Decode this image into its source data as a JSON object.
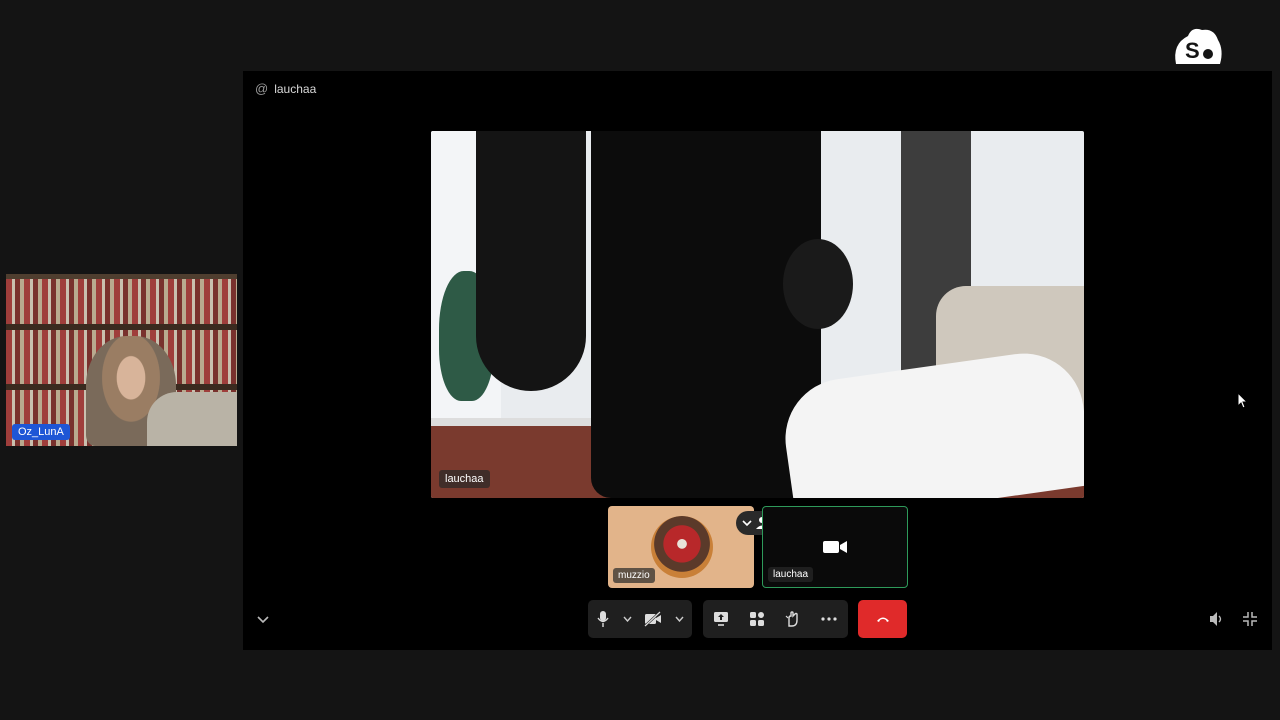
{
  "webcam": {
    "name": "Oz_LunA"
  },
  "brand": {
    "name": "streamyard"
  },
  "room": {
    "at_symbol": "@",
    "name": "lauchaa"
  },
  "main_video": {
    "participant": "lauchaa"
  },
  "thumbnails": [
    {
      "participant": "muzzio"
    },
    {
      "participant": "lauchaa"
    }
  ],
  "controls": {
    "group_a": [
      "microphone-icon",
      "chevron-down-icon",
      "camera-off-icon",
      "chevron-down-icon"
    ],
    "group_b": [
      "share-screen-icon",
      "apps-icon",
      "raise-hand-icon",
      "more-icon"
    ],
    "hangup": "hang-up-icon"
  },
  "colors": {
    "accent": "#1e56d6",
    "hangup": "#e02a2a",
    "active_border": "#2e9a5a"
  }
}
